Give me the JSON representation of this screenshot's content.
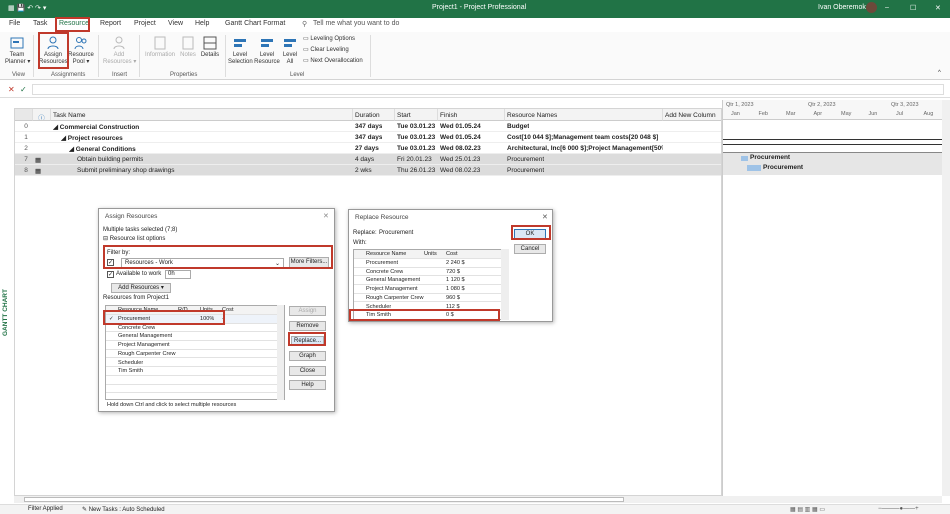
{
  "titlebar": {
    "title": "Project1 - Project Professional",
    "user": "Ivan Oberemok",
    "win_min": "–",
    "win_max": "☐",
    "win_close": "✕"
  },
  "tabs": [
    "File",
    "Task",
    "Resource",
    "Report",
    "Project",
    "View",
    "Help",
    "Gantt Chart Format"
  ],
  "search_placeholder": "Tell me what you want to do",
  "ribbon": {
    "team_planner": "Team\nPlanner ▾",
    "assign": "Assign\nResources",
    "pool": "Resource\nPool ▾",
    "add": "Add\nResources ▾",
    "information": "Information",
    "notes": "Notes",
    "details": "Details",
    "level_sel": "Level\nSelection",
    "level_res": "Level\nResource",
    "level_all": "Level\nAll",
    "leveling_options": "Leveling Options",
    "clear_leveling": "Clear Leveling",
    "next_over": "Next Overallocation",
    "groups": {
      "view": "View",
      "assignments": "Assignments",
      "insert": "Insert",
      "properties": "Properties",
      "level": "Level"
    }
  },
  "formula": {
    "cancel": "✕",
    "ok": "✓"
  },
  "sidebar_label": "GANTT CHART",
  "grid": {
    "headers": [
      "Task Name",
      "Duration",
      "Start",
      "Finish",
      "Resource Names",
      "Add New Column"
    ],
    "rows": [
      {
        "id": "0",
        "name": "◢ Commercial Construction",
        "dur": "347 days",
        "start": "Tue 03.01.23",
        "finish": "Wed 01.05.24",
        "res": "Budget",
        "bold": true,
        "indent": 0
      },
      {
        "id": "1",
        "name": "◢ Project resources",
        "dur": "347 days",
        "start": "Tue 03.01.23",
        "finish": "Wed 01.05.24",
        "res": "Cost[10 044 $];Management team costs[20 048 $]",
        "bold": true,
        "indent": 1
      },
      {
        "id": "2",
        "name": "◢ General Conditions",
        "dur": "27 days",
        "start": "Tue 03.01.23",
        "finish": "Wed 08.02.23",
        "res": "Architectural, Inc[6 000 $];Project Management[50%]",
        "bold": true,
        "indent": 2
      },
      {
        "id": "7",
        "name": "Obtain building permits",
        "dur": "4 days",
        "start": "Fri 20.01.23",
        "finish": "Wed 25.01.23",
        "res": "Procurement",
        "bold": false,
        "indent": 3,
        "sel": true
      },
      {
        "id": "8",
        "name": "Submit preliminary shop drawings",
        "dur": "2 wks",
        "start": "Thu 26.01.23",
        "finish": "Wed 08.02.23",
        "res": "Procurement",
        "bold": false,
        "indent": 3,
        "sel": true
      }
    ]
  },
  "gantt": {
    "quarters": [
      "Qtr 1, 2023",
      "Qtr 2, 2023",
      "Qtr 3, 2023"
    ],
    "months": [
      "Jan",
      "Feb",
      "Mar",
      "Apr",
      "May",
      "Jun",
      "Jul",
      "Aug"
    ],
    "bar_label_1": "Procurement",
    "bar_label_2": "Procurement"
  },
  "assign": {
    "title": "Assign Resources",
    "close": "✕",
    "tasks_selected": "Multiple tasks selected (7;8)",
    "list_options": "Resource list options",
    "filter_by": "Filter by:",
    "filter_value": "Resources - Work",
    "more_filters": "More Filters...",
    "available": "Available to work",
    "hours": "0h",
    "add_resources": "Add Resources",
    "from_label": "Resources from Project1",
    "cols": [
      "Resource Name",
      "R/D",
      "Units",
      "Cost"
    ],
    "rows": [
      {
        "check": "✓",
        "name": "Procurement",
        "units": "100%",
        "cost": "-"
      },
      {
        "check": "",
        "name": "Concrete Crew",
        "units": "",
        "cost": ""
      },
      {
        "check": "",
        "name": "General Management",
        "units": "",
        "cost": ""
      },
      {
        "check": "",
        "name": "Project Management",
        "units": "",
        "cost": ""
      },
      {
        "check": "",
        "name": "Rough Carpenter Crew",
        "units": "",
        "cost": ""
      },
      {
        "check": "",
        "name": "Scheduler",
        "units": "",
        "cost": ""
      },
      {
        "check": "",
        "name": "Tim Smith",
        "units": "",
        "cost": ""
      }
    ],
    "btn_assign": "Assign",
    "btn_remove": "Remove",
    "btn_replace": "Replace...",
    "btn_graph": "Graph",
    "btn_close": "Close",
    "btn_help": "Help",
    "hint": "Hold down Ctrl and click to select multiple resources"
  },
  "replace": {
    "title": "Replace Resource",
    "close": "✕",
    "replace_label": "Replace:",
    "replace_value": "Procurement",
    "with_label": "With:",
    "cols": [
      "Resource Name",
      "Units",
      "Cost"
    ],
    "rows": [
      {
        "name": "Procurement",
        "units": "",
        "cost": "2 240 $"
      },
      {
        "name": "Concrete Crew",
        "units": "",
        "cost": "720 $"
      },
      {
        "name": "General Management",
        "units": "",
        "cost": "1 120 $"
      },
      {
        "name": "Project Management",
        "units": "",
        "cost": "1 080 $"
      },
      {
        "name": "Rough Carpenter Crew",
        "units": "",
        "cost": "960 $"
      },
      {
        "name": "Scheduler",
        "units": "",
        "cost": "112 $"
      },
      {
        "name": "Tim Smith",
        "units": "",
        "cost": "0 $"
      }
    ],
    "ok": "OK",
    "cancel": "Cancel"
  },
  "status": {
    "filter": "Filter Applied",
    "new_tasks": "New Tasks : Auto Scheduled"
  }
}
